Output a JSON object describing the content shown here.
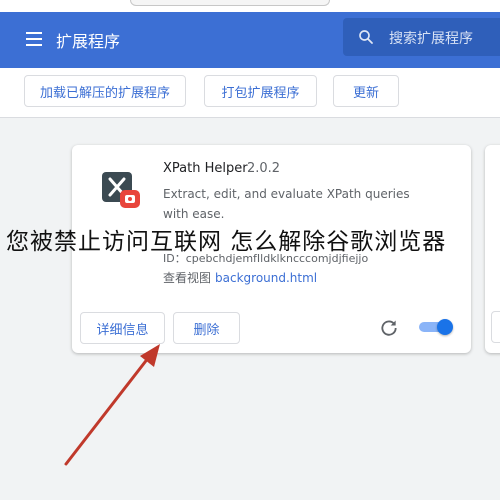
{
  "header": {
    "title": "扩展程序",
    "search_placeholder": "搜索扩展程序"
  },
  "toolbar": {
    "load_unpacked": "加载已解压的扩展程序",
    "pack": "打包扩展程序",
    "update": "更新"
  },
  "extension": {
    "name": "XPath Helper",
    "version": "2.0.2",
    "description": "Extract, edit, and evaluate XPath queries with ease.",
    "id": "ID：cpebchdjemfIldklkncccomjdjfiejjo",
    "views_label": "查看视图",
    "views_link": "background.html",
    "details_button": "详细信息",
    "remove_button": "删除",
    "enabled": true
  },
  "overlay": {
    "text": "您被禁止访问互联网   怎么解除谷歌浏览器"
  },
  "colors": {
    "header": "#3c6fd4",
    "accent": "#1a73e8",
    "arrow": "#c0392b",
    "icon_badge": "#e8453c"
  }
}
